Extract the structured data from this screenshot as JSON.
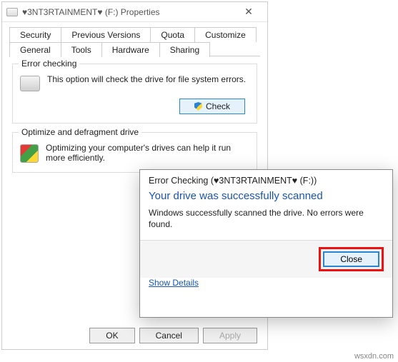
{
  "window": {
    "title": "♥3NT3RTAINMENT♥ (F:) Properties",
    "close_glyph": "✕"
  },
  "tabs": {
    "row1": [
      "Security",
      "Previous Versions",
      "Quota",
      "Customize"
    ],
    "row2": [
      "General",
      "Tools",
      "Hardware",
      "Sharing"
    ],
    "active": "Tools"
  },
  "error_checking": {
    "legend": "Error checking",
    "text": "This option will check the drive for file system errors.",
    "button": "Check"
  },
  "defrag": {
    "legend": "Optimize and defragment drive",
    "text": "Optimizing your computer's drives can help it run more efficiently."
  },
  "footer": {
    "ok": "OK",
    "cancel": "Cancel",
    "apply": "Apply"
  },
  "dialog": {
    "title": "Error Checking (♥3NT3RTAINMENT♥ (F:))",
    "heading": "Your drive was successfully scanned",
    "body": "Windows successfully scanned the drive. No errors were found.",
    "close": "Close",
    "details": "Show Details"
  },
  "watermark": "wsxdn.com"
}
